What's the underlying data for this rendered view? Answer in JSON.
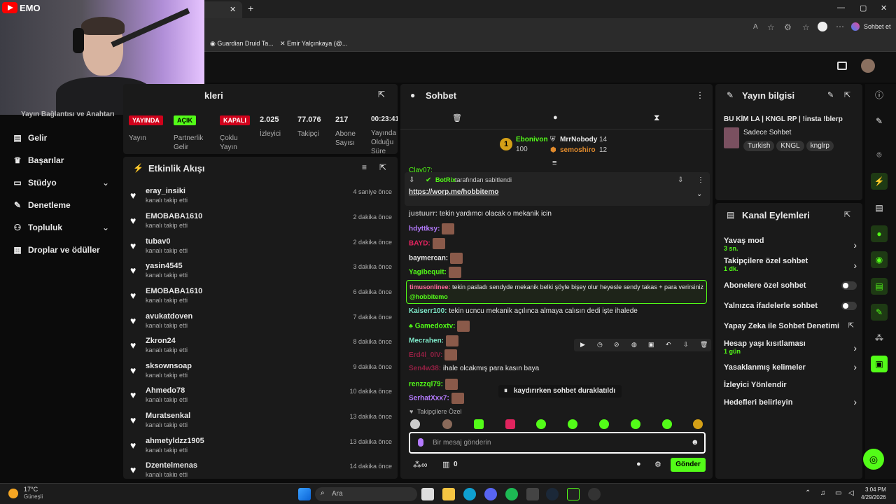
{
  "browser": {
    "close_tab": "✕",
    "new_tab": "+",
    "bookmarks": [
      "Guardian Druid Ta...",
      "Emir Yalçınkaya (@..."
    ],
    "sohbet_et": "Sohbet et",
    "window_controls": [
      "—",
      "▢",
      "✕"
    ]
  },
  "webcam": {
    "channel": "EMO"
  },
  "sidebar": {
    "partial_heading": "Yayın Bağlantısı ve Anahtarı",
    "items": [
      {
        "label": "Gelir",
        "icon": "money-icon"
      },
      {
        "label": "Başarılar",
        "icon": "trophy-icon"
      },
      {
        "label": "Stüdyo",
        "icon": "studio-icon"
      },
      {
        "label": "Denetleme",
        "icon": "wrench-icon"
      },
      {
        "label": "Topluluk",
        "icon": "community-icon"
      },
      {
        "label": "Droplar ve ödüller",
        "icon": "drops-icon"
      }
    ]
  },
  "stats": {
    "header_partial": "kleri",
    "columns": [
      {
        "badge": "YAYINDA",
        "label": "Yayın"
      },
      {
        "badge": "AÇIK",
        "label": "Partnerlik Gelir"
      },
      {
        "badge": "KAPALI",
        "label": "Çoklu Yayın"
      },
      {
        "value": "2.025",
        "label": "İzleyici"
      },
      {
        "value": "77.076",
        "label": "Takipçi"
      },
      {
        "value": "217",
        "label": "Abone Sayısı"
      },
      {
        "value": "00:23:41",
        "label": "Yayında Olduğu Süre"
      }
    ]
  },
  "activity": {
    "title": "Etkinlik Akışı",
    "items": [
      {
        "name": "eray_insiki",
        "action": "kanalı takip etti",
        "time": "4 saniye önce"
      },
      {
        "name": "EMOBABA1610",
        "action": "kanalı takip etti",
        "time": "2 dakika önce"
      },
      {
        "name": "tubav0",
        "action": "kanalı takip etti",
        "time": "2 dakika önce"
      },
      {
        "name": "yasin4545",
        "action": "kanalı takip etti",
        "time": "3 dakika önce"
      },
      {
        "name": "EMOBABA1610",
        "action": "kanalı takip etti",
        "time": "6 dakika önce"
      },
      {
        "name": "avukatdoven",
        "action": "kanalı takip etti",
        "time": "7 dakika önce"
      },
      {
        "name": "Zkron24",
        "action": "kanalı takip etti",
        "time": "8 dakika önce"
      },
      {
        "name": "sksownsoap",
        "action": "kanalı takip etti",
        "time": "9 dakika önce"
      },
      {
        "name": "Ahmedo78",
        "action": "kanalı takip etti",
        "time": "10 dakika önce"
      },
      {
        "name": "Muratsenkal",
        "action": "kanalı takip etti",
        "time": "13 dakika önce"
      },
      {
        "name": "ahmetyldzz1905",
        "action": "kanalı takip etti",
        "time": "13 dakika önce"
      },
      {
        "name": "Dzentelmenas",
        "action": "kanalı takip etti",
        "time": "14 dakika önce"
      }
    ]
  },
  "chat": {
    "title": "Sohbet",
    "leaderboard": {
      "rank1_name": "Ebonivon",
      "rank1_count": "100",
      "rank2_name": "MrrNobody",
      "rank2_count": "14",
      "rank3_name": "semoshiro",
      "rank3_count": "12",
      "rank1_badge": "1"
    },
    "partial_user": "Clay07:",
    "pinned": {
      "by": "BotRix",
      "suffix": "tarafından sabitlendi",
      "link": "https://worp.me/hobbitemo"
    },
    "messages": [
      {
        "user": "justuurr:",
        "text": "tekin yardımcı olacak o mekanik icin",
        "color": "#adadad"
      },
      {
        "user": "hdyttksy:",
        "text": "",
        "color": "#b57bff"
      },
      {
        "user": "BAYD:",
        "text": "",
        "color": "#e0245e"
      },
      {
        "user": "baymercan:",
        "text": "",
        "color": "#e8e8e8"
      },
      {
        "user": "Yagibequit:",
        "text": "",
        "color": "#53fc18"
      },
      {
        "user": "timusonlinee:",
        "text": "tekin pasladı sendyde mekanik belki şöyle bişey olur heyesle sendy takas + para verirsiniz",
        "mention": "@hobbitemo",
        "color": "#ff6b9d"
      },
      {
        "user": "Kaiserr100:",
        "text": "tekin ucncu mekanik açılınca almaya calısın dedi işte ihalede",
        "color": "#7ee7c8"
      },
      {
        "user": "Gamedoxtv:",
        "text": "",
        "color": "#53fc18"
      },
      {
        "user": "Mecrahen:",
        "text": "",
        "color": "#7ee7c8"
      },
      {
        "user": "Erd4l_0lV:",
        "text": "",
        "color": "#e0245e"
      },
      {
        "user": "Sen4w38:",
        "text": "ihale olcakmış para kasın baya",
        "color": "#e0245e"
      },
      {
        "user": "renzzql79:",
        "text": "",
        "color": "#53fc18"
      },
      {
        "user": "SerhatXxx7:",
        "text": "",
        "color": "#b57bff"
      }
    ],
    "paused": "kaydırırken sohbet duraklatıldı",
    "followers_only": "Takipçilere Özel",
    "input_placeholder": "Bir mesaj gönderin",
    "footer_count": "0",
    "send_label": "Gönder"
  },
  "stream_info": {
    "title": "Yayın bilgisi",
    "stream_title": "BU KİM LA | KNGL RP | !insta !blerp",
    "category": "Sadece Sohbet",
    "tags": [
      "Turkish",
      "KNGL",
      "knglrp"
    ]
  },
  "channel_actions": {
    "title": "Kanal Eylemleri",
    "items": [
      {
        "label": "Yavaş mod",
        "sub": "3 sn.",
        "type": "chevron"
      },
      {
        "label": "Takipçilere özel sohbet",
        "sub": "1 dk.",
        "type": "chevron"
      },
      {
        "label": "Abonelere özel sohbet",
        "sub": "",
        "type": "toggle"
      },
      {
        "label": "Yalnızca ifadelerle sohbet",
        "sub": "",
        "type": "toggle"
      },
      {
        "label": "Yapay Zeka ile Sohbet Denetimi",
        "sub": "",
        "type": "external"
      },
      {
        "label": "Hesap yaşı kısıtlaması",
        "sub": "1 gün",
        "type": "chevron"
      },
      {
        "label": "Yasaklanmış kelimeler",
        "sub": "",
        "type": "chevron"
      },
      {
        "label": "İzleyici Yönlendir",
        "sub": "",
        "type": "none"
      },
      {
        "label": "Hedefleri belirleyin",
        "sub": "",
        "type": "chevron"
      }
    ]
  },
  "taskbar": {
    "temp": "17°C",
    "weather": "Güneşli",
    "search": "Ara",
    "time": "3:04 PM",
    "date": "4/29/2026"
  },
  "colors": {
    "accent": "#53fc18",
    "live": "#d0021b"
  }
}
